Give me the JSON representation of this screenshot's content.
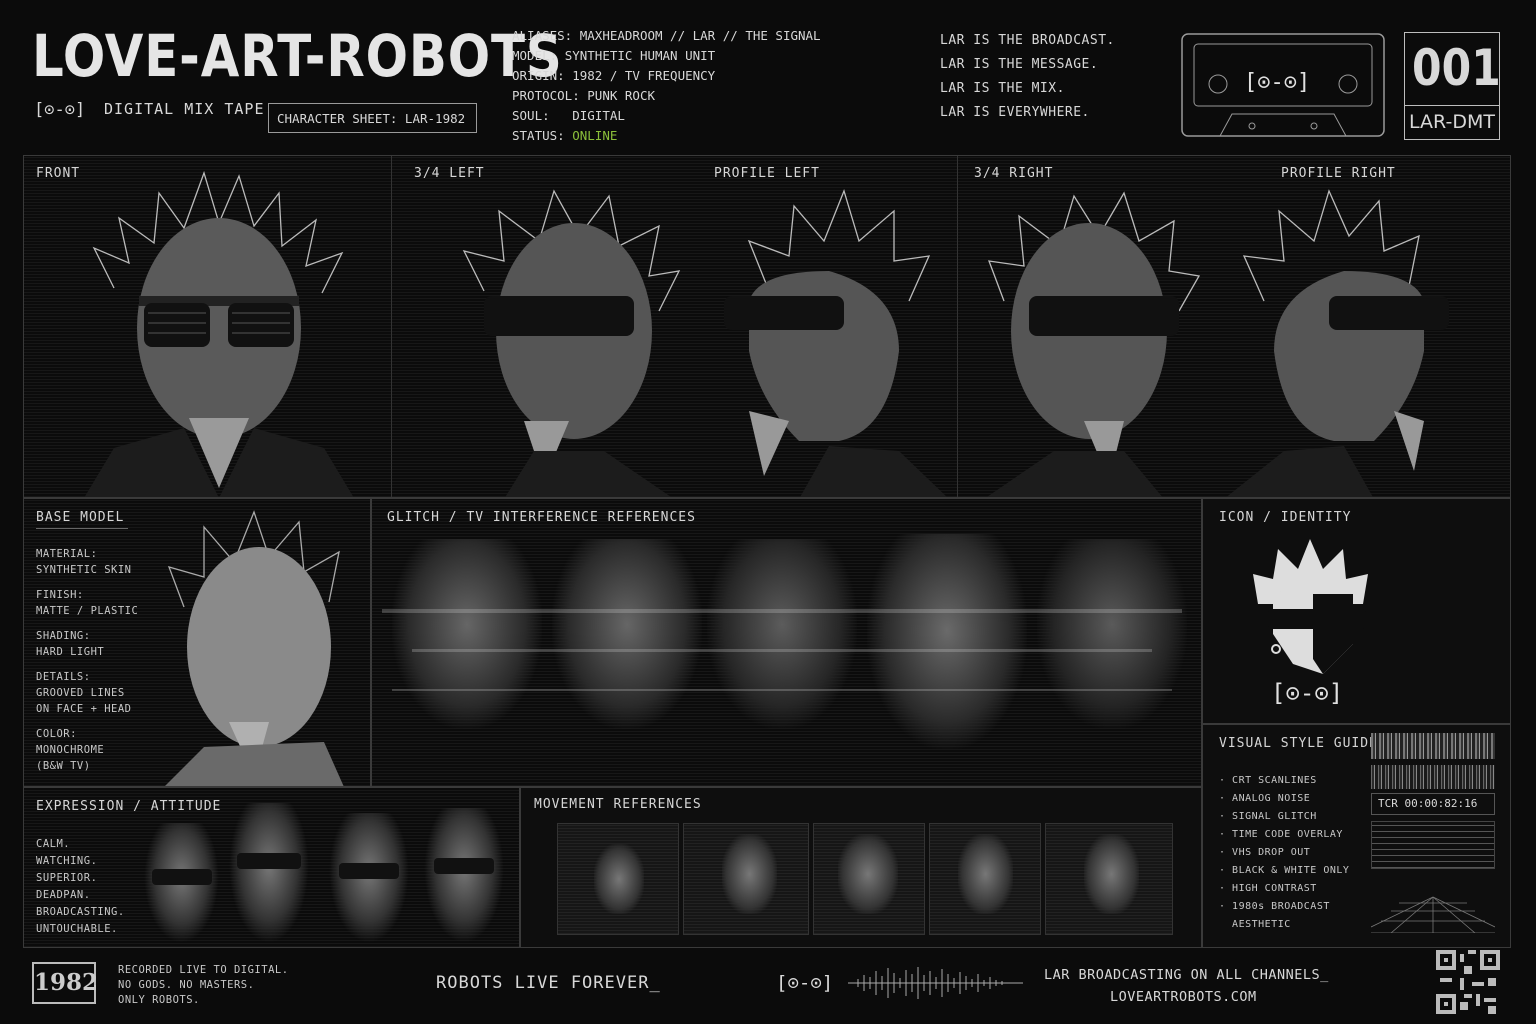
{
  "header": {
    "title": "LOVE-ART-ROBOTS",
    "logo_glyph": "[⊙-⊙]",
    "subtitle": "DIGITAL MIX TAPE",
    "sheet_label": "CHARACTER SHEET: LAR-1982",
    "specs": [
      {
        "k": "ALIASES:",
        "v": "MAXHEADROOM // LAR // THE SIGNAL"
      },
      {
        "k": "MODEL:",
        "v": "SYNTHETIC HUMAN UNIT"
      },
      {
        "k": "ORIGIN:",
        "v": "1982 / TV FREQUENCY"
      },
      {
        "k": "PROTOCOL:",
        "v": "PUNK ROCK"
      },
      {
        "k": "SOUL:",
        "v": "DIGITAL"
      },
      {
        "k": "STATUS:",
        "v": "ONLINE"
      }
    ],
    "manifesto": [
      "LAR IS THE BROADCAST.",
      "LAR IS THE MESSAGE.",
      "LAR IS THE MIX.",
      "LAR IS EVERYWHERE."
    ],
    "tape_label": "[⊙-⊙]",
    "number": "001",
    "code": "LAR-DMT"
  },
  "turnaround": {
    "views": [
      "FRONT",
      "3/4 LEFT",
      "PROFILE LEFT",
      "3/4 RIGHT",
      "PROFILE RIGHT"
    ]
  },
  "base_model": {
    "title": "BASE MODEL",
    "props": [
      {
        "k": "MATERIAL:",
        "v": "SYNTHETIC SKIN"
      },
      {
        "k": "FINISH:",
        "v": "MATTE / PLASTIC"
      },
      {
        "k": "SHADING:",
        "v": "HARD LIGHT"
      },
      {
        "k": "DETAILS:",
        "v": "GROOVED LINES",
        "v2": "ON FACE + HEAD"
      },
      {
        "k": "COLOR:",
        "v": "MONOCHROME",
        "v2": "(B&W TV)"
      }
    ]
  },
  "glitch": {
    "title": "GLITCH / TV INTERFERENCE REFERENCES"
  },
  "icon": {
    "title": "ICON / IDENTITY",
    "glyph": "[⊙-⊙]"
  },
  "expression": {
    "title": "EXPRESSION / ATTITUDE",
    "words": [
      "CALM.",
      "WATCHING.",
      "SUPERIOR.",
      "DEADPAN.",
      "BROADCASTING.",
      "UNTOUCHABLE."
    ]
  },
  "movement": {
    "title": "MOVEMENT REFERENCES"
  },
  "style_guide": {
    "title": "VISUAL STYLE GUIDE",
    "items": [
      "CRT SCANLINES",
      "ANALOG NOISE",
      "SIGNAL GLITCH",
      "TIME CODE OVERLAY",
      "VHS DROP OUT",
      "BLACK & WHITE ONLY",
      "HIGH CONTRAST",
      "1980s BROADCAST",
      "AESTHETIC"
    ],
    "timecode": "TCR 00:00:82:16"
  },
  "footer": {
    "year": "1982",
    "notes": [
      "RECORDED LIVE TO DIGITAL.",
      "NO GODS. NO MASTERS.",
      "ONLY ROBOTS."
    ],
    "slogan": "ROBOTS LIVE FOREVER_",
    "glyph": "[⊙-⊙]",
    "broadcast": "LAR BROADCASTING ON ALL CHANNELS_",
    "url": "LOVEARTROBOTS.COM"
  },
  "colors": {
    "bg": "#0b0b0b",
    "accent_online": "#8bbf3a",
    "border": "#3a3a3a"
  }
}
